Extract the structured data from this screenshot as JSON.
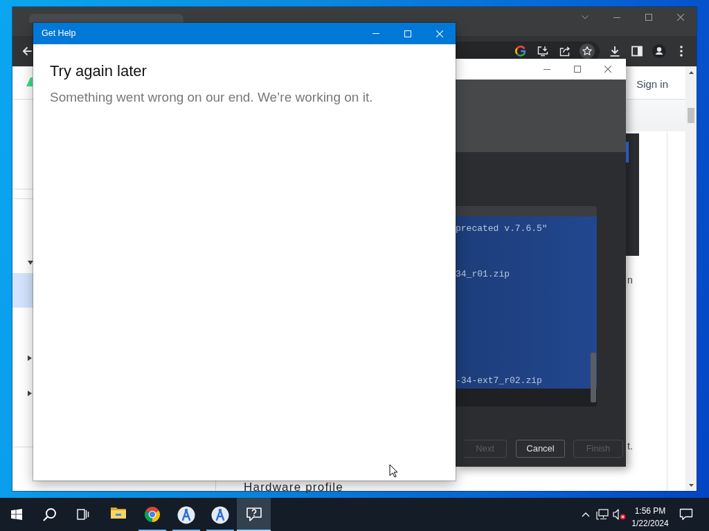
{
  "browser": {
    "sign_in": "Sign in",
    "nav_rows": [
      {
        "kind": "group",
        "expanded": true,
        "selected": false
      },
      {
        "kind": "page",
        "selected": true
      },
      {
        "kind": "group",
        "expanded": false,
        "selected": false
      },
      {
        "kind": "group",
        "expanded": false,
        "selected": false
      }
    ],
    "text_fragments": [
      "n",
      "t."
    ],
    "section_heading": "Hardware profile"
  },
  "sdk_dialog": {
    "log_lines": [
      "precated v.7.6.5\"",
      "34_r01.zip",
      "-34-ext7_r02.zip"
    ],
    "buttons": [
      {
        "label": "Next",
        "disabled": true
      },
      {
        "label": "Cancel",
        "disabled": false
      },
      {
        "label": "Finish",
        "disabled": true
      }
    ]
  },
  "get_help": {
    "title": "Get Help",
    "heading": "Try again later",
    "message": "Something went wrong on our end. We’re working on it."
  },
  "taskbar": {
    "apps": [
      {
        "kind": "folder",
        "running": false,
        "selected": false
      },
      {
        "kind": "browser",
        "running": true,
        "selected": false
      },
      {
        "kind": "studio",
        "running": true,
        "selected": false
      },
      {
        "kind": "studio",
        "running": true,
        "selected": false
      },
      {
        "kind": "help",
        "running": true,
        "selected": true
      }
    ],
    "tray": {
      "muted": true
    },
    "clock": {
      "time": "1:56 PM",
      "date": "1/22/2024"
    }
  }
}
